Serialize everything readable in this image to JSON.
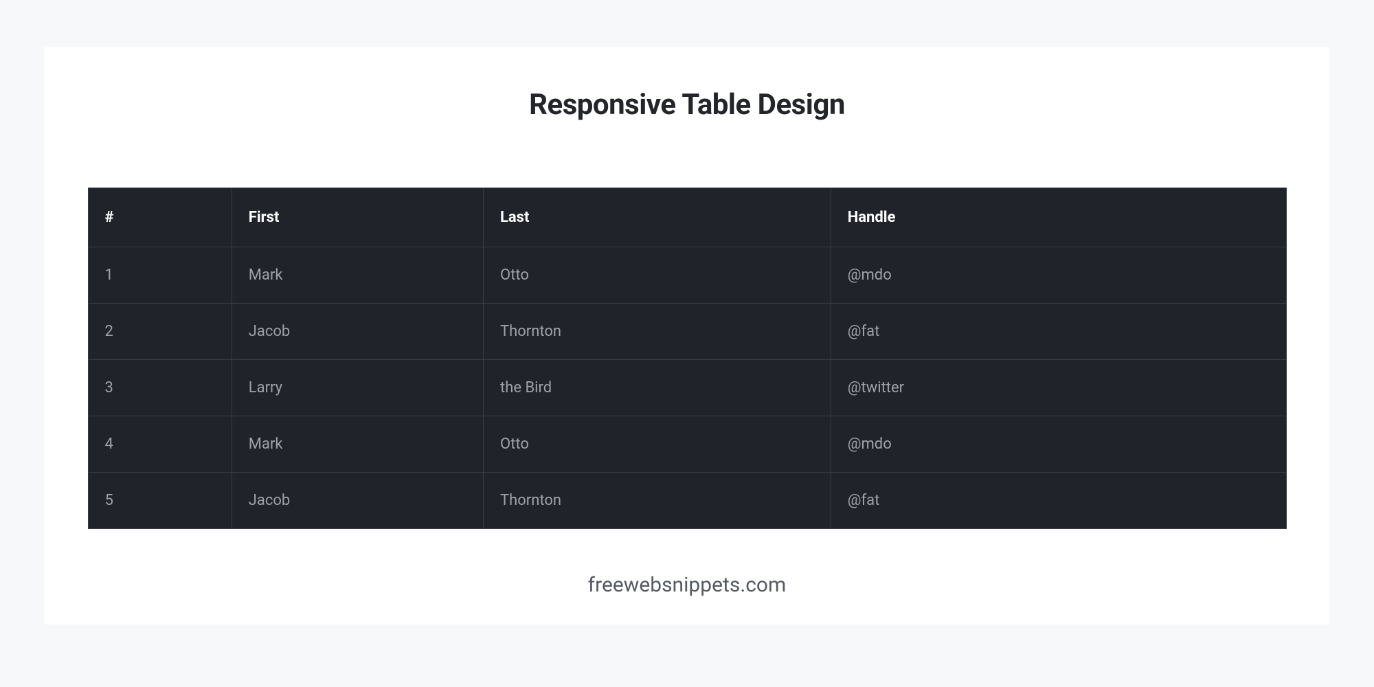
{
  "title": "Responsive Table Design",
  "table": {
    "headers": {
      "idx": "#",
      "first": "First",
      "last": "Last",
      "handle": "Handle"
    },
    "rows": [
      {
        "idx": "1",
        "first": "Mark",
        "last": "Otto",
        "handle": "@mdo"
      },
      {
        "idx": "2",
        "first": "Jacob",
        "last": "Thornton",
        "handle": "@fat"
      },
      {
        "idx": "3",
        "first": "Larry",
        "last": "the Bird",
        "handle": "@twitter"
      },
      {
        "idx": "4",
        "first": "Mark",
        "last": "Otto",
        "handle": "@mdo"
      },
      {
        "idx": "5",
        "first": "Jacob",
        "last": "Thornton",
        "handle": "@fat"
      }
    ]
  },
  "footer": "freewebsnippets.com"
}
